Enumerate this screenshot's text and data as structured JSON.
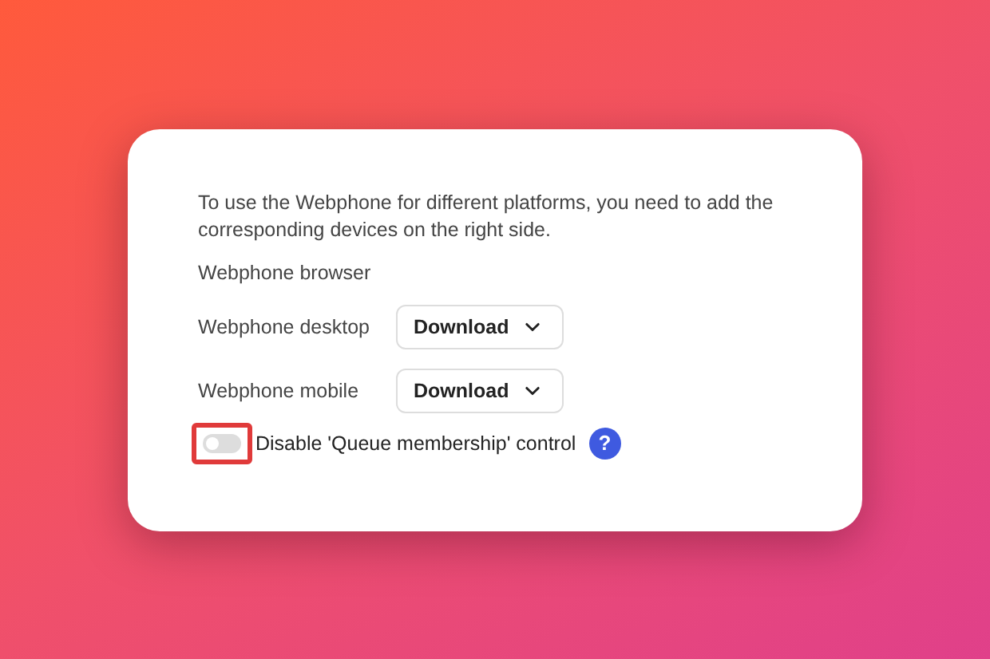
{
  "card": {
    "intro": "To use the Webphone for different platforms, you need to add the corresponding devices on the right side.",
    "rows": [
      {
        "label": "Webphone browser",
        "kind": "plain"
      },
      {
        "label": "Webphone desktop",
        "kind": "download",
        "button": "Download"
      },
      {
        "label": "Webphone mobile",
        "kind": "download",
        "button": "Download"
      }
    ],
    "toggle": {
      "label": "Disable 'Queue membership' control",
      "on": false,
      "highlighted": true,
      "help": "?"
    }
  }
}
